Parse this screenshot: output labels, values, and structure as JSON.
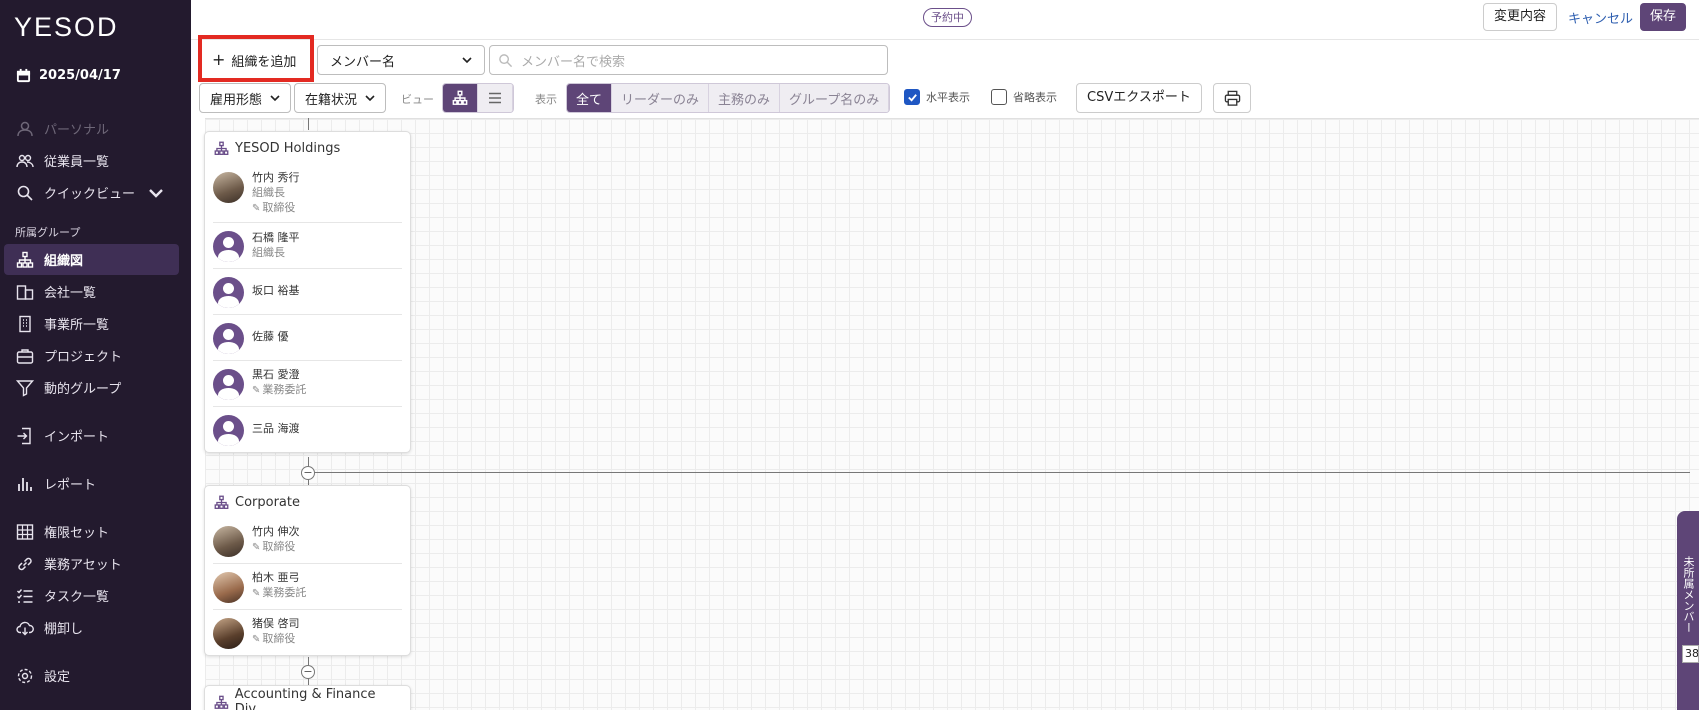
{
  "sidebar": {
    "logo": "YESOD",
    "date": "2025/04/17",
    "items": [
      {
        "label": "パーソナル",
        "name": "sidebar-item-personal"
      },
      {
        "label": "従業員一覧",
        "name": "sidebar-item-employees"
      },
      {
        "label": "クイックビュー",
        "name": "sidebar-item-quickview"
      },
      {
        "label": "組織図",
        "name": "sidebar-item-orgchart"
      },
      {
        "label": "会社一覧",
        "name": "sidebar-item-companies"
      },
      {
        "label": "事業所一覧",
        "name": "sidebar-item-offices"
      },
      {
        "label": "プロジェクト",
        "name": "sidebar-item-projects"
      },
      {
        "label": "動的グループ",
        "name": "sidebar-item-dynamic-groups"
      },
      {
        "label": "インポート",
        "name": "sidebar-item-import"
      },
      {
        "label": "レポート",
        "name": "sidebar-item-report"
      },
      {
        "label": "権限セット",
        "name": "sidebar-item-permissions"
      },
      {
        "label": "業務アセット",
        "name": "sidebar-item-assets"
      },
      {
        "label": "タスク一覧",
        "name": "sidebar-item-tasks"
      },
      {
        "label": "棚卸し",
        "name": "sidebar-item-inventory"
      },
      {
        "label": "設定",
        "name": "sidebar-item-settings"
      }
    ],
    "section_label": "所属グループ"
  },
  "topbar": {
    "status_badge": "予約中",
    "changes_label": "変更内容",
    "cancel_label": "キャンセル",
    "save_label": "保存"
  },
  "toolbar": {
    "add_org_label": "組織を追加",
    "member_select": "メンバー名",
    "search_placeholder": "メンバー名で検索",
    "employment_type": "雇用形態",
    "status": "在籍状況",
    "view_label": "ビュー",
    "display_label": "表示",
    "display_options": [
      "全て",
      "リーダーのみ",
      "主務のみ",
      "グループ名のみ"
    ],
    "horizontal_label": "水平表示",
    "horizontal_checked": true,
    "compact_label": "省略表示",
    "compact_checked": false,
    "csv_label": "CSVエクスポート"
  },
  "orgs": [
    {
      "title": "YESOD Holdings",
      "members": [
        {
          "name": "竹内 秀行",
          "role": "組織長",
          "position": "取締役",
          "avatar": "photo"
        },
        {
          "name": "石橋 隆平",
          "role": "組織長",
          "position": "",
          "avatar": "default"
        },
        {
          "name": "坂口 裕基",
          "role": "",
          "position": "",
          "avatar": "default"
        },
        {
          "name": "佐藤 優",
          "role": "",
          "position": "",
          "avatar": "default"
        },
        {
          "name": "黒石 愛澄",
          "role": "",
          "position": "業務委託",
          "avatar": "default"
        },
        {
          "name": "三品 海渡",
          "role": "",
          "position": "",
          "avatar": "default"
        }
      ]
    },
    {
      "title": "Corporate",
      "members": [
        {
          "name": "竹内 伸次",
          "role": "",
          "position": "取締役",
          "avatar": "photo"
        },
        {
          "name": "柏木 亜弓",
          "role": "",
          "position": "業務委託",
          "avatar": "photo"
        },
        {
          "name": "猪俣 啓司",
          "role": "",
          "position": "取締役",
          "avatar": "photo"
        }
      ]
    },
    {
      "title": "Accounting & Finance Div...",
      "members": []
    }
  ],
  "side_tab": {
    "label": "未所属メンバー",
    "count": "38"
  }
}
